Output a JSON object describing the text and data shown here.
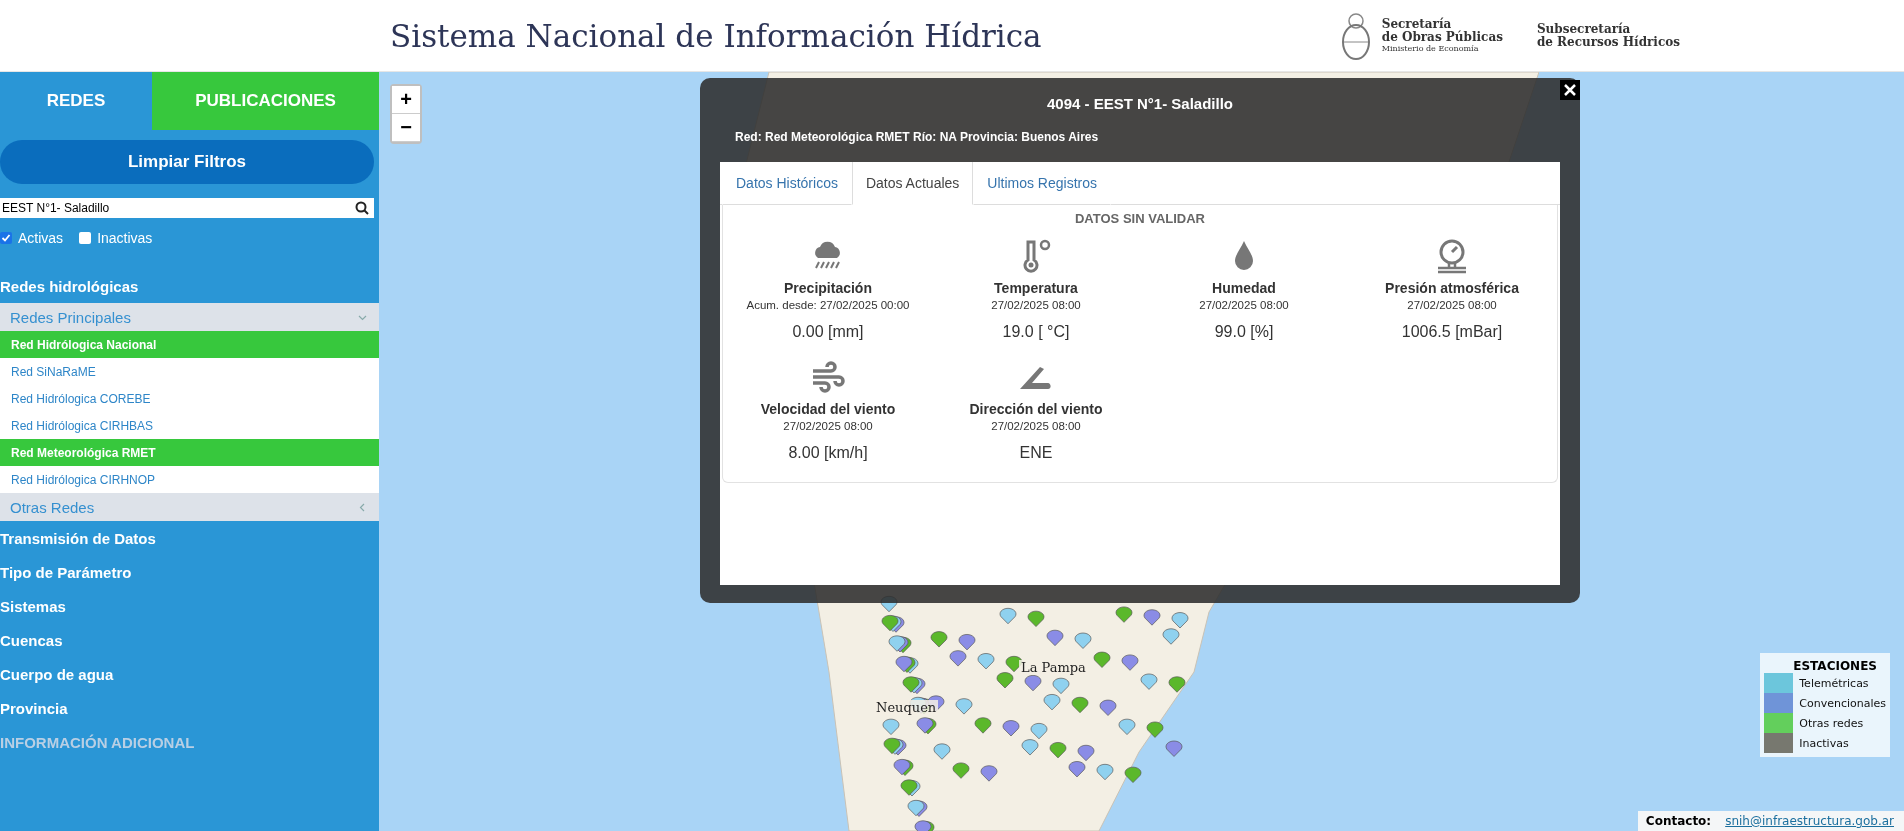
{
  "header": {
    "title": "Sistema Nacional de Información Hídrica",
    "secretaria": {
      "lines": [
        "Secretaría",
        "de Obras Públicas"
      ],
      "subline": "Ministerio de Economía"
    },
    "subsecretaria": {
      "lines": [
        "Subsecretaría",
        "de Recursos Hídricos"
      ]
    }
  },
  "sidebar": {
    "tabs": [
      {
        "label": "REDES",
        "selected": true
      },
      {
        "label": "PUBLICACIONES",
        "selected": false
      }
    ],
    "clear_button": "Limpiar Filtros",
    "search": {
      "value": "EEST N°1- Saladillo"
    },
    "checkboxes": [
      {
        "label": "Activas",
        "checked": true
      },
      {
        "label": "Inactivas",
        "checked": false
      }
    ],
    "section_title": "Redes hidrológicas",
    "groups": [
      {
        "label": "Redes Principales",
        "expanded": true,
        "items": [
          {
            "label": "Red Hidrólogica Nacional",
            "selected": true
          },
          {
            "label": "Red SiNaRaME",
            "selected": false
          },
          {
            "label": "Red Hidrólogica COREBE",
            "selected": false
          },
          {
            "label": "Red Hidrólogica CIRHBAS",
            "selected": false
          },
          {
            "label": "Red Meteorológica RMET",
            "selected": true
          },
          {
            "label": "Red Hidrólogica CIRHNOP",
            "selected": false
          }
        ]
      },
      {
        "label": "Otras Redes",
        "expanded": false
      }
    ],
    "menu": [
      {
        "label": "Transmisión de Datos",
        "kind": "filter"
      },
      {
        "label": "Tipo de Parámetro",
        "kind": "filter"
      },
      {
        "label": "Sistemas",
        "kind": "filter"
      },
      {
        "label": "Cuencas",
        "kind": "filter"
      },
      {
        "label": "Cuerpo de agua",
        "kind": "filter"
      },
      {
        "label": "Provincia",
        "kind": "filter"
      },
      {
        "label": "INFORMACIÓN ADICIONAL",
        "kind": "info"
      }
    ]
  },
  "map": {
    "zoom_buttons": [
      "+",
      "−"
    ],
    "labels": [
      {
        "text": "La Pampa"
      },
      {
        "text": "Neuquen"
      }
    ]
  },
  "popup": {
    "title": "4094 - EEST N°1- Saladillo",
    "info": [
      {
        "label": "Red:",
        "value": "Red Meteorológica RMET"
      },
      {
        "label": "Río:",
        "value": "NA"
      },
      {
        "label": "Provincia:",
        "value": "Buenos Aires"
      }
    ],
    "tabs": [
      {
        "label": "Datos Históricos",
        "selected": false
      },
      {
        "label": "Datos Actuales",
        "selected": true
      },
      {
        "label": "Ultimos Registros",
        "selected": false
      }
    ],
    "heading": "DATOS SIN VALIDAR",
    "readings": [
      {
        "kind": "precipitation",
        "name": "Precipitación",
        "date": "Acum. desde: 27/02/2025 00:00",
        "value": "0.00 [mm]"
      },
      {
        "kind": "temperature",
        "name": "Temperatura",
        "date": "27/02/2025 08:00",
        "value": "19.0 [ °C]"
      },
      {
        "kind": "humidity",
        "name": "Humedad",
        "date": "27/02/2025 08:00",
        "value": "99.0 [%]"
      },
      {
        "kind": "pressure",
        "name": "Presión atmosférica",
        "date": "27/02/2025 08:00",
        "value": "1006.5 [mBar]"
      },
      {
        "kind": "wind_speed",
        "name": "Velocidad del viento",
        "date": "27/02/2025 08:00",
        "value": "8.00 [km/h]"
      },
      {
        "kind": "wind_direction",
        "name": "Dirección del viento",
        "date": "27/02/2025 08:00",
        "value": "ENE"
      }
    ]
  },
  "legend": {
    "title": "ESTACIONES",
    "items": [
      {
        "label": "Telemétricas",
        "color": "#6cc6dc"
      },
      {
        "label": "Convencionales",
        "color": "#6f94d8"
      },
      {
        "label": "Otras redes",
        "color": "#63cf5c"
      },
      {
        "label": "Inactivas",
        "color": "#77786f"
      }
    ]
  },
  "contact": {
    "label": "Contacto:",
    "email": "snih@infraestructura.gob.ar"
  }
}
